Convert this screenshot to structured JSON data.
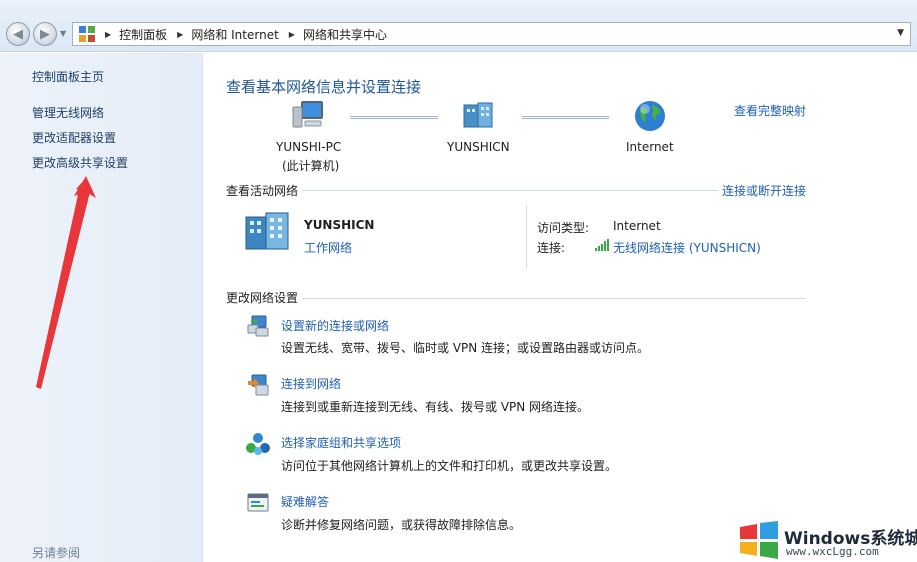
{
  "address_bar": {
    "crumbs": [
      "控制面板",
      "网络和 Internet",
      "网络和共享中心"
    ]
  },
  "sidebar": {
    "home": "控制面板主页",
    "items": [
      "管理无线网络",
      "更改适配器设置",
      "更改高级共享设置"
    ],
    "see_also": "另请参阅"
  },
  "main": {
    "title": "查看基本网络信息并设置连接",
    "full_map_link": "查看完整映射",
    "map": {
      "computer_name": "YUNSHI-PC",
      "computer_sub": "(此计算机)",
      "network_name": "YUNSHICN",
      "internet_label": "Internet"
    },
    "active": {
      "header": "查看活动网络",
      "connect_link": "连接或断开连接",
      "network_name": "YUNSHICN",
      "network_type": "工作网络",
      "access_type_key": "访问类型:",
      "access_type_val": "Internet",
      "connection_key": "连接:",
      "connection_val": "无线网络连接 (YUNSHICN)"
    },
    "change": {
      "header": "更改网络设置",
      "tasks": [
        {
          "title": "设置新的连接或网络",
          "desc": "设置无线、宽带、拨号、临时或 VPN 连接；或设置路由器或访问点。"
        },
        {
          "title": "连接到网络",
          "desc": "连接到或重新连接到无线、有线、拨号或 VPN 网络连接。"
        },
        {
          "title": "选择家庭组和共享选项",
          "desc": "访问位于其他网络计算机上的文件和打印机，或更改共享设置。"
        },
        {
          "title": "疑难解答",
          "desc": "诊断并修复网络问题，或获得故障排除信息。"
        }
      ]
    }
  },
  "watermark": {
    "title": "Windows系统城",
    "url": "www.wxcLgg.com"
  },
  "colors": {
    "link": "#1f5fb4",
    "title": "#1f5796",
    "arrow": "#e8373a"
  }
}
